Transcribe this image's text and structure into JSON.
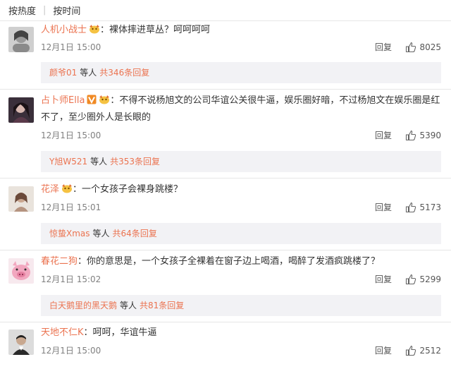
{
  "sort_tabs": {
    "hot": "按热度",
    "time": "按时间"
  },
  "reply_label": "回复",
  "comments": [
    {
      "user": "人机小战士",
      "badges": [
        "vip-badge"
      ],
      "text": "裸体摔进草丛？呵呵呵呵",
      "time": "12月1日 15:00",
      "likes": "8025",
      "sub_user": "颜爷01",
      "sub_mid": "等人",
      "sub_count": "共346条回复"
    },
    {
      "user": "占卜师Ella",
      "badges": [
        "verified-v-badge",
        "vip-badge"
      ],
      "text": "不得不说杨旭文的公司华谊公关很牛逼，娱乐圈好暗，不过杨旭文在娱乐圈是红不了，至少圈外人是长眼的",
      "time": "12月1日 15:00",
      "likes": "5390",
      "sub_user": "Y旭W521",
      "sub_mid": "等人",
      "sub_count": "共353条回复"
    },
    {
      "user": "花泽",
      "badges": [
        "vip-badge"
      ],
      "text": "一个女孩子会裸身跳楼？",
      "time": "12月1日 15:01",
      "likes": "5173",
      "sub_user": "惊蛰Xmas",
      "sub_mid": "等人",
      "sub_count": "共64条回复"
    },
    {
      "user": "春花二狗",
      "badges": [],
      "text": "你的意思是，一个女孩子全裸着在窗子边上喝酒，喝醉了发酒疯跳楼了？",
      "time": "12月1日 15:02",
      "likes": "5299",
      "sub_user": "白天鹅里的黑天鹅",
      "sub_mid": "等人",
      "sub_count": "共81条回复"
    },
    {
      "user": "天地不仁K",
      "badges": [],
      "text": "呵呵，华谊牛逼",
      "time": "12月1日 15:00",
      "likes": "2512"
    }
  ],
  "colors": {
    "username": "#eb7350",
    "text": "#333333",
    "meta": "#808080",
    "subbox_bg": "#f2f2f5"
  }
}
